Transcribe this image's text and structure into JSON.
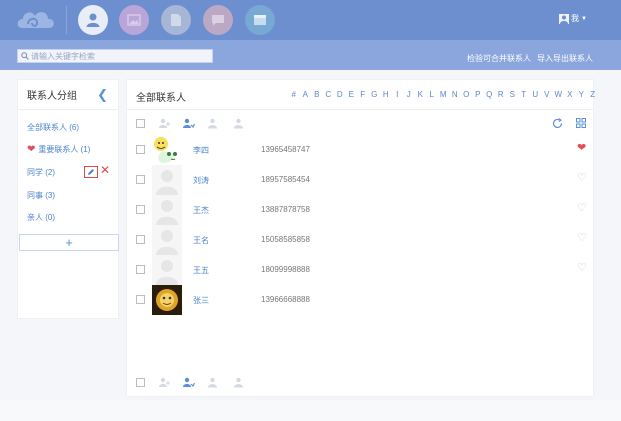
{
  "topbar": {
    "nav": [
      {
        "icon": "person-icon"
      },
      {
        "icon": "photo-icon"
      },
      {
        "icon": "document-icon"
      },
      {
        "icon": "message-icon"
      },
      {
        "icon": "calendar-icon"
      }
    ],
    "user_label": "我"
  },
  "subbar": {
    "search_placeholder": "请输入关键字检索",
    "link_check": "检验可合并联系人",
    "link_import_export": "导入导出联系人"
  },
  "groups_panel": {
    "title": "联系人分组",
    "groups": [
      {
        "label": "全部联系人 (6)"
      },
      {
        "label": "重要联系人 (1)"
      },
      {
        "label": "同学 (2)"
      },
      {
        "label": "同事 (3)"
      },
      {
        "label": "亲人 (0)"
      }
    ],
    "add_label": "+"
  },
  "contacts_panel": {
    "title": "全部联系人",
    "alphabet": [
      "#",
      "A",
      "B",
      "C",
      "D",
      "E",
      "F",
      "G",
      "H",
      "I",
      "J",
      "K",
      "L",
      "M",
      "N",
      "O",
      "P",
      "Q",
      "R",
      "S",
      "T",
      "U",
      "V",
      "W",
      "X",
      "Y",
      "Z"
    ],
    "contacts": [
      {
        "name": "李四",
        "phone": "13965458747",
        "favorite": true
      },
      {
        "name": "刘涛",
        "phone": "18957585454",
        "favorite": false
      },
      {
        "name": "王杰",
        "phone": "13887878758",
        "favorite": false
      },
      {
        "name": "王名",
        "phone": "15058585858",
        "favorite": false
      },
      {
        "name": "王五",
        "phone": "18099998888",
        "favorite": false
      },
      {
        "name": "张三",
        "phone": "13966668888",
        "favorite": false
      }
    ]
  },
  "colors": {
    "topbar": "#6d8fcf",
    "subbar": "#8aa6dc",
    "link": "#4d84cf",
    "favorite": "#e34b56"
  }
}
